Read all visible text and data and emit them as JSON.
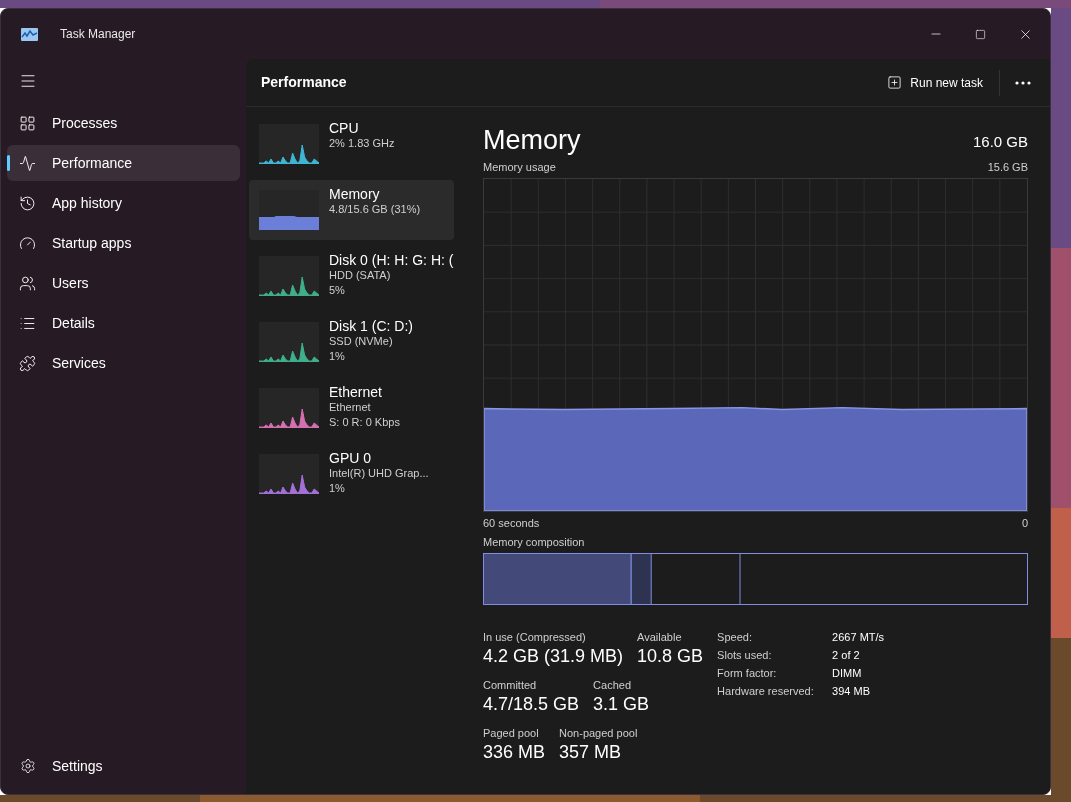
{
  "window": {
    "title": "Task Manager"
  },
  "sidebar": {
    "items": [
      {
        "label": "Processes",
        "selected": false
      },
      {
        "label": "Performance",
        "selected": true
      },
      {
        "label": "App history",
        "selected": false
      },
      {
        "label": "Startup apps",
        "selected": false
      },
      {
        "label": "Users",
        "selected": false
      },
      {
        "label": "Details",
        "selected": false
      },
      {
        "label": "Services",
        "selected": false
      }
    ],
    "footer": {
      "label": "Settings"
    }
  },
  "header": {
    "title": "Performance",
    "run_new_task": "Run new task"
  },
  "devices": [
    {
      "name": "CPU",
      "lines": [
        "2%  1.83 GHz"
      ],
      "color": "#3fb5d4",
      "kind": "spikes",
      "selected": false
    },
    {
      "name": "Memory",
      "lines": [
        "4.8/15.6 GB (31%)"
      ],
      "color": "#6b7fd8",
      "kind": "area",
      "selected": true
    },
    {
      "name": "Disk 0 (H: H: G: H: (",
      "lines": [
        "HDD (SATA)",
        "5%"
      ],
      "color": "#3fae8a",
      "kind": "spikes",
      "selected": false
    },
    {
      "name": "Disk 1 (C: D:)",
      "lines": [
        "SSD (NVMe)",
        "1%"
      ],
      "color": "#3fae8a",
      "kind": "spikes",
      "selected": false
    },
    {
      "name": "Ethernet",
      "lines": [
        "Ethernet",
        "S: 0 R: 0 Kbps"
      ],
      "color": "#d46fb0",
      "kind": "spikes",
      "selected": false
    },
    {
      "name": "GPU 0",
      "lines": [
        "Intel(R) UHD Grap...",
        "1%"
      ],
      "color": "#a46fd8",
      "kind": "spikes",
      "selected": false
    }
  ],
  "detail": {
    "title": "Memory",
    "total": "16.0 GB",
    "usage_label": "Memory usage",
    "usage_max": "15.6 GB",
    "x_start": "60 seconds",
    "x_end": "0",
    "composition_label": "Memory composition",
    "stats": [
      [
        {
          "label": "In use (Compressed)",
          "value": "4.2 GB (31.9 MB)"
        },
        {
          "label": "Available",
          "value": "10.8 GB"
        }
      ],
      [
        {
          "label": "Committed",
          "value": "4.7/18.5 GB"
        },
        {
          "label": "Cached",
          "value": "3.1 GB"
        }
      ],
      [
        {
          "label": "Paged pool",
          "value": "336 MB"
        },
        {
          "label": "Non-paged pool",
          "value": "357 MB"
        }
      ]
    ],
    "specs": [
      {
        "label": "Speed:",
        "value": "2667 MT/s"
      },
      {
        "label": "Slots used:",
        "value": "2 of 2"
      },
      {
        "label": "Form factor:",
        "value": "DIMM"
      },
      {
        "label": "Hardware reserved:",
        "value": "394 MB"
      }
    ]
  }
}
